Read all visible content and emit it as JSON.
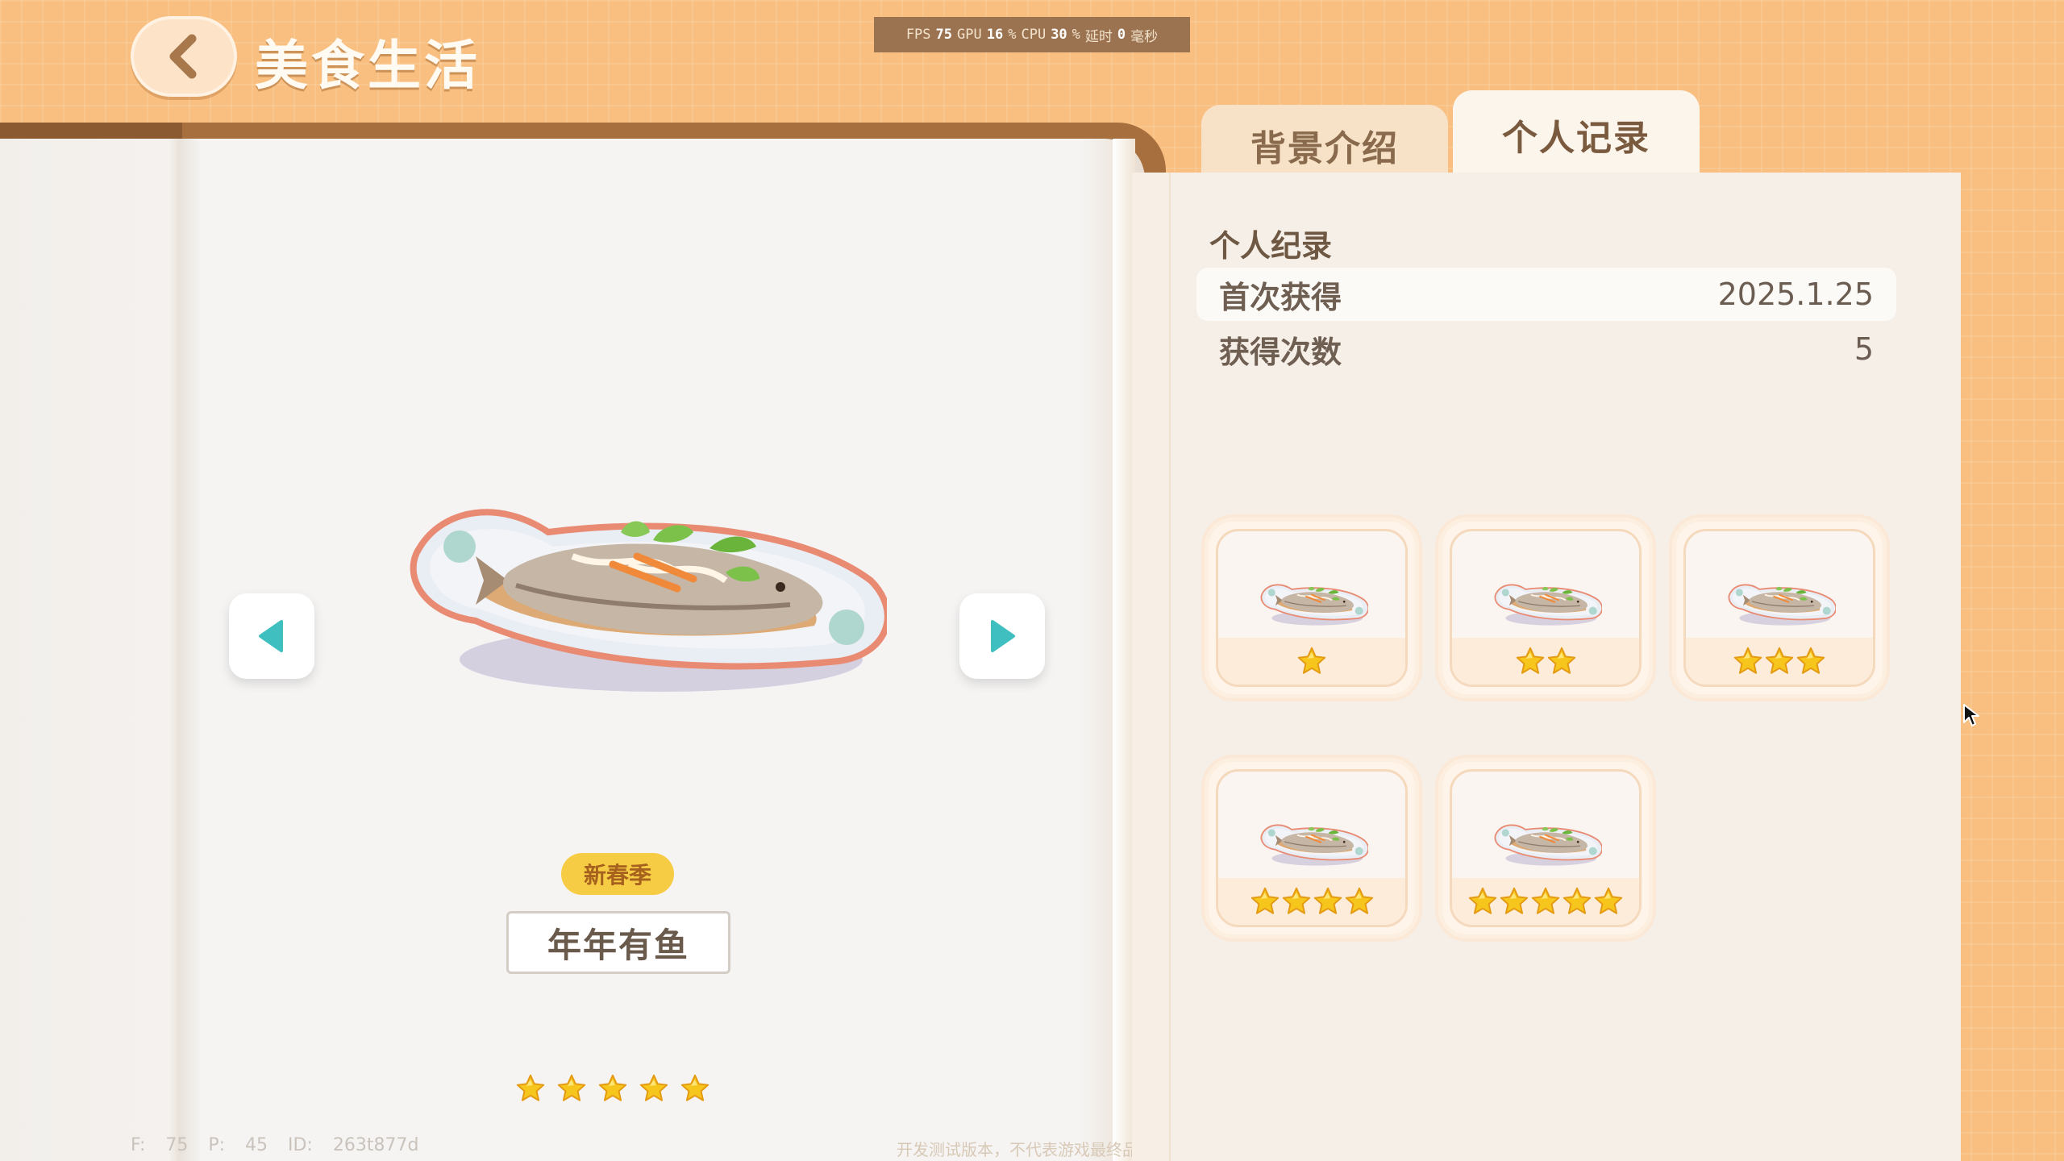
{
  "header": {
    "title": "美食生活",
    "back_icon": "chevron-left-icon"
  },
  "perf": {
    "fps_label": "FPS",
    "fps_value": "75",
    "gpu_label": "GPU",
    "gpu_value": "16",
    "gpu_unit": "%",
    "cpu_label": "CPU",
    "cpu_value": "30",
    "cpu_unit": "%",
    "latency_label": "延时",
    "latency_value": "0",
    "latency_unit": "毫秒"
  },
  "tabs": [
    {
      "label": "背景介绍",
      "active": false
    },
    {
      "label": "个人记录",
      "active": true
    }
  ],
  "dish": {
    "season": "新春季",
    "name": "年年有鱼",
    "stars": 5
  },
  "record": {
    "section_title": "个人纪录",
    "rows": [
      {
        "label": "首次获得",
        "value": "2025.1.25"
      },
      {
        "label": "获得次数",
        "value": "5"
      }
    ]
  },
  "variants": [
    {
      "stars": 1
    },
    {
      "stars": 2
    },
    {
      "stars": 3
    },
    {
      "stars": 4
    },
    {
      "stars": 5
    }
  ],
  "debug": {
    "text": "F: 75 P: 45 ID: 263t877d"
  },
  "watermark": "开发测试版本，不代表游戏最终品质",
  "colors": {
    "accent_teal": "#3fbfbf",
    "star_gold": "#f5c518",
    "background_orange": "#f8bf80"
  }
}
